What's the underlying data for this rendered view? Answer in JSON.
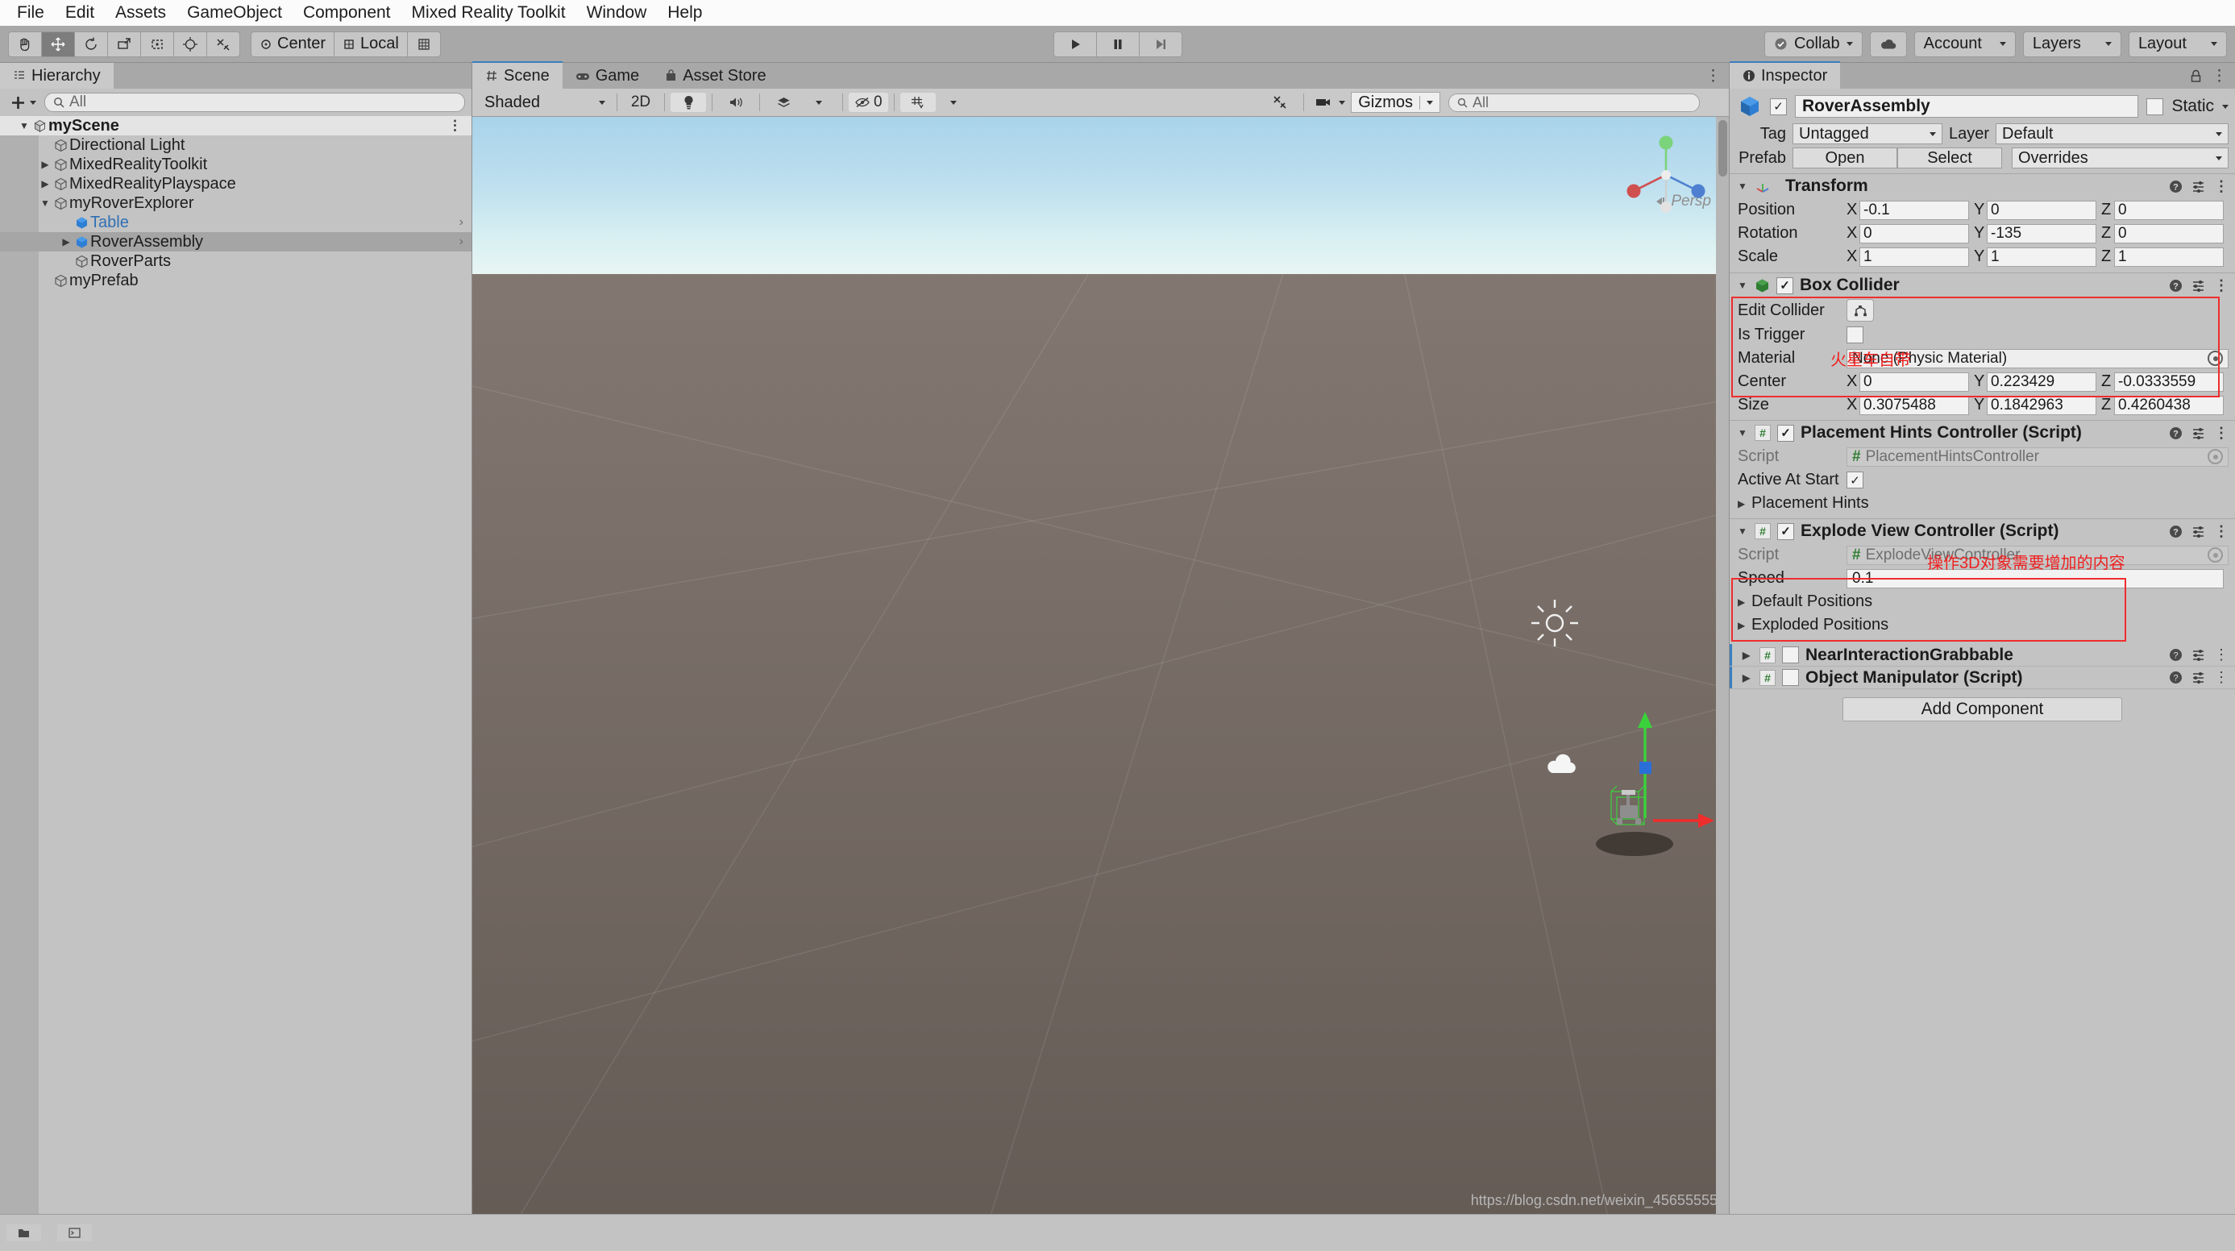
{
  "menubar": {
    "items": [
      "File",
      "Edit",
      "Assets",
      "GameObject",
      "Component",
      "Mixed Reality Toolkit",
      "Window",
      "Help"
    ]
  },
  "toolbar": {
    "transform_tools": [
      {
        "name": "hand-tool",
        "active": false
      },
      {
        "name": "move-tool",
        "active": true
      },
      {
        "name": "rotate-tool",
        "active": false
      },
      {
        "name": "scale-tool",
        "active": false
      },
      {
        "name": "rect-tool",
        "active": false
      },
      {
        "name": "transform-tool",
        "active": false
      },
      {
        "name": "custom-editor-tool",
        "active": false
      }
    ],
    "pivot_mode": "Center",
    "pivot_rotation": "Local",
    "grid_snap_label": "",
    "play": "play-button",
    "pause": "pause-button",
    "step": "step-button",
    "collab_label": "Collab",
    "cloud_label": "cloud-icon",
    "account_label": "Account",
    "layers_label": "Layers",
    "layout_label": "Layout"
  },
  "hierarchy": {
    "tab_label": "Hierarchy",
    "create_label": "+",
    "search_placeholder": "All",
    "rows": [
      {
        "label": "myScene",
        "depth": 0,
        "arrow": "down",
        "icon": "unity-scene-icon",
        "state": "scene",
        "bold": true
      },
      {
        "label": "Directional Light",
        "depth": 1,
        "arrow": "none",
        "icon": "gameobject-icon",
        "state": "normal"
      },
      {
        "label": "MixedRealityToolkit",
        "depth": 1,
        "arrow": "right",
        "icon": "gameobject-icon",
        "state": "normal"
      },
      {
        "label": "MixedRealityPlayspace",
        "depth": 1,
        "arrow": "right",
        "icon": "gameobject-icon",
        "state": "normal"
      },
      {
        "label": "myRoverExplorer",
        "depth": 1,
        "arrow": "down",
        "icon": "gameobject-icon",
        "state": "normal"
      },
      {
        "label": "Table",
        "depth": 2,
        "arrow": "none",
        "icon": "prefab-icon",
        "state": "prefab"
      },
      {
        "label": "RoverAssembly",
        "depth": 2,
        "arrow": "right",
        "icon": "prefab-icon",
        "state": "selected"
      },
      {
        "label": "RoverParts",
        "depth": 2,
        "arrow": "none",
        "icon": "gameobject-icon",
        "state": "normal"
      },
      {
        "label": "myPrefab",
        "depth": 1,
        "arrow": "none",
        "icon": "gameobject-icon",
        "state": "normal"
      }
    ]
  },
  "scene": {
    "tabs": [
      {
        "label": "Scene",
        "icon": "scene-grid-icon",
        "active": true
      },
      {
        "label": "Game",
        "icon": "gamepad-icon",
        "active": false
      },
      {
        "label": "Asset Store",
        "icon": "store-bag-icon",
        "active": false
      }
    ],
    "draw_mode": "Shaded",
    "twod_label": "2D",
    "lighting_icon": "light-bulb-icon",
    "audio_icon": "speaker-icon",
    "fx_icon": "effects-icon",
    "hidden_count": "0",
    "grid_icon": "grid-visibility-icon",
    "tools_icon": "scene-tools-icon",
    "camera_icon": "scene-camera-icon",
    "gizmos_label": "Gizmos",
    "search_placeholder": "All",
    "persp_label": "Persp",
    "gizmo_axes": [
      "X",
      "Y",
      "Z"
    ],
    "watermark": "https://blog.csdn.net/weixin_45655555"
  },
  "inspector": {
    "tab_label": "Inspector",
    "object_name": "RoverAssembly",
    "object_enabled": true,
    "static_label": "Static",
    "tag_label": "Tag",
    "tag_value": "Untagged",
    "layer_label": "Layer",
    "layer_value": "Default",
    "prefab_label": "Prefab",
    "prefab_open": "Open",
    "prefab_select": "Select",
    "prefab_overrides": "Overrides",
    "transform": {
      "title": "Transform",
      "position_label": "Position",
      "position": {
        "x": "-0.1",
        "y": "0",
        "z": "0"
      },
      "rotation_label": "Rotation",
      "rotation": {
        "x": "0",
        "y": "-135",
        "z": "0"
      },
      "scale_label": "Scale",
      "scale": {
        "x": "1",
        "y": "1",
        "z": "1"
      }
    },
    "box_collider": {
      "title": "Box Collider",
      "enabled": true,
      "edit_collider_label": "Edit Collider",
      "is_trigger_label": "Is Trigger",
      "is_trigger": false,
      "material_label": "Material",
      "material_value": "None (Physic Material)",
      "center_label": "Center",
      "center": {
        "x": "0",
        "y": "0.223429",
        "z": "-0.0333559"
      },
      "size_label": "Size",
      "size": {
        "x": "0.3075488",
        "y": "0.1842963",
        "z": "0.4260438"
      },
      "annotation": "火星车自带"
    },
    "placement_hints": {
      "title": "Placement Hints Controller (Script)",
      "enabled": true,
      "script_label": "Script",
      "script_value": "PlacementHintsController",
      "active_at_start_label": "Active At Start",
      "active_at_start": true,
      "list_label": "Placement Hints"
    },
    "explode_view": {
      "title": "Explode View Controller (Script)",
      "enabled": true,
      "script_label": "Script",
      "script_value": "ExplodeViewController",
      "speed_label": "Speed",
      "speed_value": "0.1",
      "default_positions_label": "Default Positions",
      "exploded_positions_label": "Exploded Positions"
    },
    "mrtk_components": {
      "annotation": "操作3D对象需要增加的内容",
      "items": [
        {
          "title": "NearInteractionGrabbable",
          "enabled": false
        },
        {
          "title": "Object Manipulator (Script)",
          "enabled": false
        }
      ]
    },
    "add_component_label": "Add Component"
  },
  "colors": {
    "accent_blue": "#3a7ebf",
    "annotation_red": "#ef2020",
    "prefab_blue": "#2f6fb5",
    "collider_green": "#2f7d32",
    "panel_bg": "#c3c3c3",
    "toolbar_bg": "#a8a8a8"
  }
}
